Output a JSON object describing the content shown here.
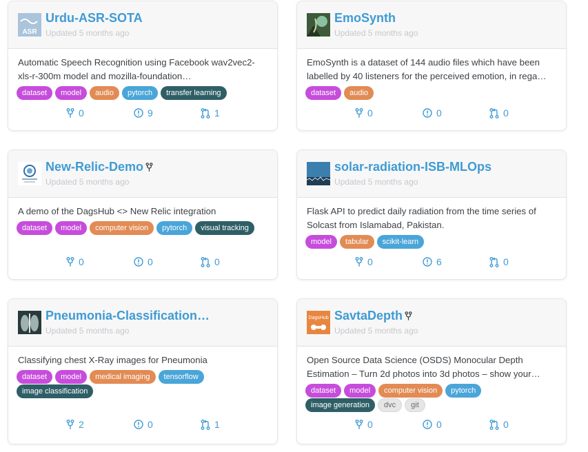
{
  "cards": [
    {
      "title": "Urdu-ASR-SOTA",
      "updated": "Updated 5 months ago",
      "thumb": "urdu-asr-logo",
      "thumb_text": "ASR",
      "description": "Automatic Speech Recognition using Facebook wav2vec2-xls-r-300m model and mozilla-foundation…",
      "tags": [
        {
          "label": "dataset",
          "color": "magenta"
        },
        {
          "label": "model",
          "color": "magenta"
        },
        {
          "label": "audio",
          "color": "orange"
        },
        {
          "label": "pytorch",
          "color": "blue"
        },
        {
          "label": "transfer learning",
          "color": "teal"
        }
      ],
      "forks": "0",
      "issues": "9",
      "pulls": "1"
    },
    {
      "title": "EmoSynth",
      "updated": "Updated 5 months ago",
      "thumb": "emosynth-image",
      "description": "EmoSynth is a dataset of 144 audio files which have been labelled by 40 listeners for the perceived emotion, in rega…",
      "tags": [
        {
          "label": "dataset",
          "color": "magenta"
        },
        {
          "label": "audio",
          "color": "orange"
        }
      ],
      "forks": "0",
      "issues": "0",
      "pulls": "0"
    },
    {
      "title": "New-Relic-Demo",
      "updated": "Updated 5 months ago",
      "thumb": "new-relic-logo",
      "description": "A demo of the DagsHub <> New Relic integration",
      "tags": [
        {
          "label": "dataset",
          "color": "magenta"
        },
        {
          "label": "model",
          "color": "magenta"
        },
        {
          "label": "computer vision",
          "color": "orange"
        },
        {
          "label": "pytorch",
          "color": "blue"
        },
        {
          "label": "visual tracking",
          "color": "teal"
        }
      ],
      "forks": "0",
      "issues": "0",
      "pulls": "0"
    },
    {
      "title": "solar-radiation-ISB-MLOps",
      "updated": "Updated 5 months ago",
      "thumb": "solar-chart-image",
      "description": "Flask API to predict daily radiation from the time series of Solcast from Islamabad, Pakistan.",
      "tags": [
        {
          "label": "model",
          "color": "magenta"
        },
        {
          "label": "tabular",
          "color": "orange"
        },
        {
          "label": "scikit-learn",
          "color": "blue"
        }
      ],
      "forks": "0",
      "issues": "6",
      "pulls": "0"
    },
    {
      "title": "Pneumonia-Classification…",
      "updated": "Updated 5 months ago",
      "thumb": "xray-image",
      "description": "Classifying chest X-Ray images for Pneumonia",
      "tags": [
        {
          "label": "dataset",
          "color": "magenta"
        },
        {
          "label": "model",
          "color": "magenta"
        },
        {
          "label": "medical imaging",
          "color": "orange"
        },
        {
          "label": "tensorflow",
          "color": "blue"
        },
        {
          "label": "image classification",
          "color": "teal"
        }
      ],
      "forks": "2",
      "issues": "0",
      "pulls": "1"
    },
    {
      "title": "SavtaDepth",
      "updated": "Updated 5 months ago",
      "thumb": "dagshub-logo",
      "thumb_text": "DagsHub",
      "description": "Open Source Data Science (OSDS) Monocular Depth Estimation – Turn 2d photos into 3d photos – show your…",
      "tags": [
        {
          "label": "dataset",
          "color": "magenta"
        },
        {
          "label": "model",
          "color": "magenta"
        },
        {
          "label": "computer vision",
          "color": "orange"
        },
        {
          "label": "pytorch",
          "color": "blue"
        },
        {
          "label": "image generation",
          "color": "teal"
        },
        {
          "label": "dvc",
          "color": "gray"
        },
        {
          "label": "git",
          "color": "gray"
        }
      ],
      "forks": "0",
      "issues": "0",
      "pulls": "0"
    }
  ]
}
